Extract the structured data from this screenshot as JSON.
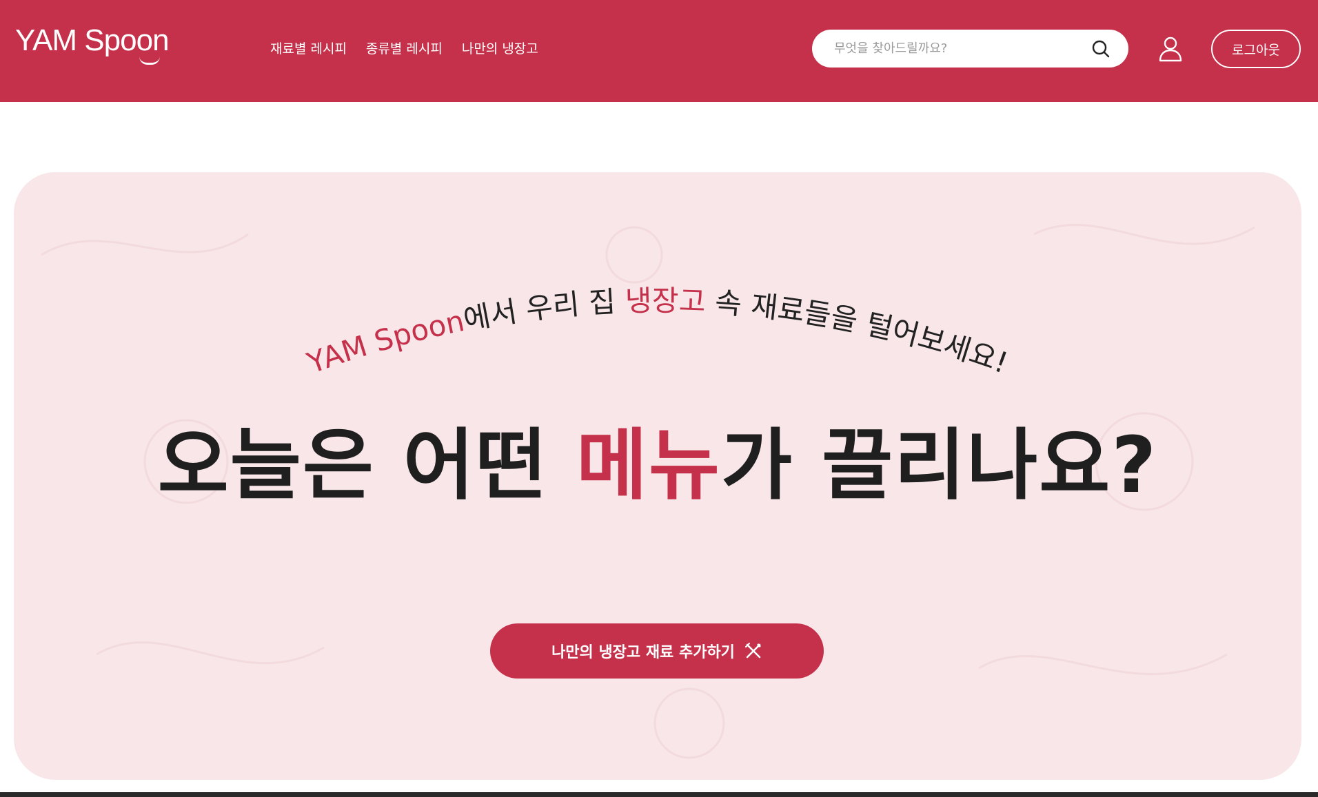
{
  "brand": {
    "logo_text": "YAM Spoon"
  },
  "nav": {
    "items": [
      {
        "label": "재료별 레시피"
      },
      {
        "label": "종류별 레시피"
      },
      {
        "label": "나만의 냉장고"
      }
    ]
  },
  "search": {
    "placeholder": "무엇을 찾아드릴까요?",
    "value": ""
  },
  "header": {
    "logout_label": "로그아웃"
  },
  "hero": {
    "subtitle_brand": "YAM Spoon",
    "subtitle_mid": "에서 우리 집 ",
    "subtitle_accent": "냉장고",
    "subtitle_end": " 속 재료들을 털어보세요!",
    "headline_pre": "오늘은 어떤 ",
    "headline_accent": "메뉴",
    "headline_post": "가 끌리나요?",
    "cta_label": "나만의 냉장고 재료 추가하기"
  },
  "colors": {
    "brand": "#c5304a",
    "hero_bg": "#f8e6e8",
    "text_dark": "#1f1f1f",
    "white": "#ffffff"
  },
  "icons": {
    "search": "search-icon",
    "user": "user-icon",
    "cta": "utensils-icon"
  }
}
